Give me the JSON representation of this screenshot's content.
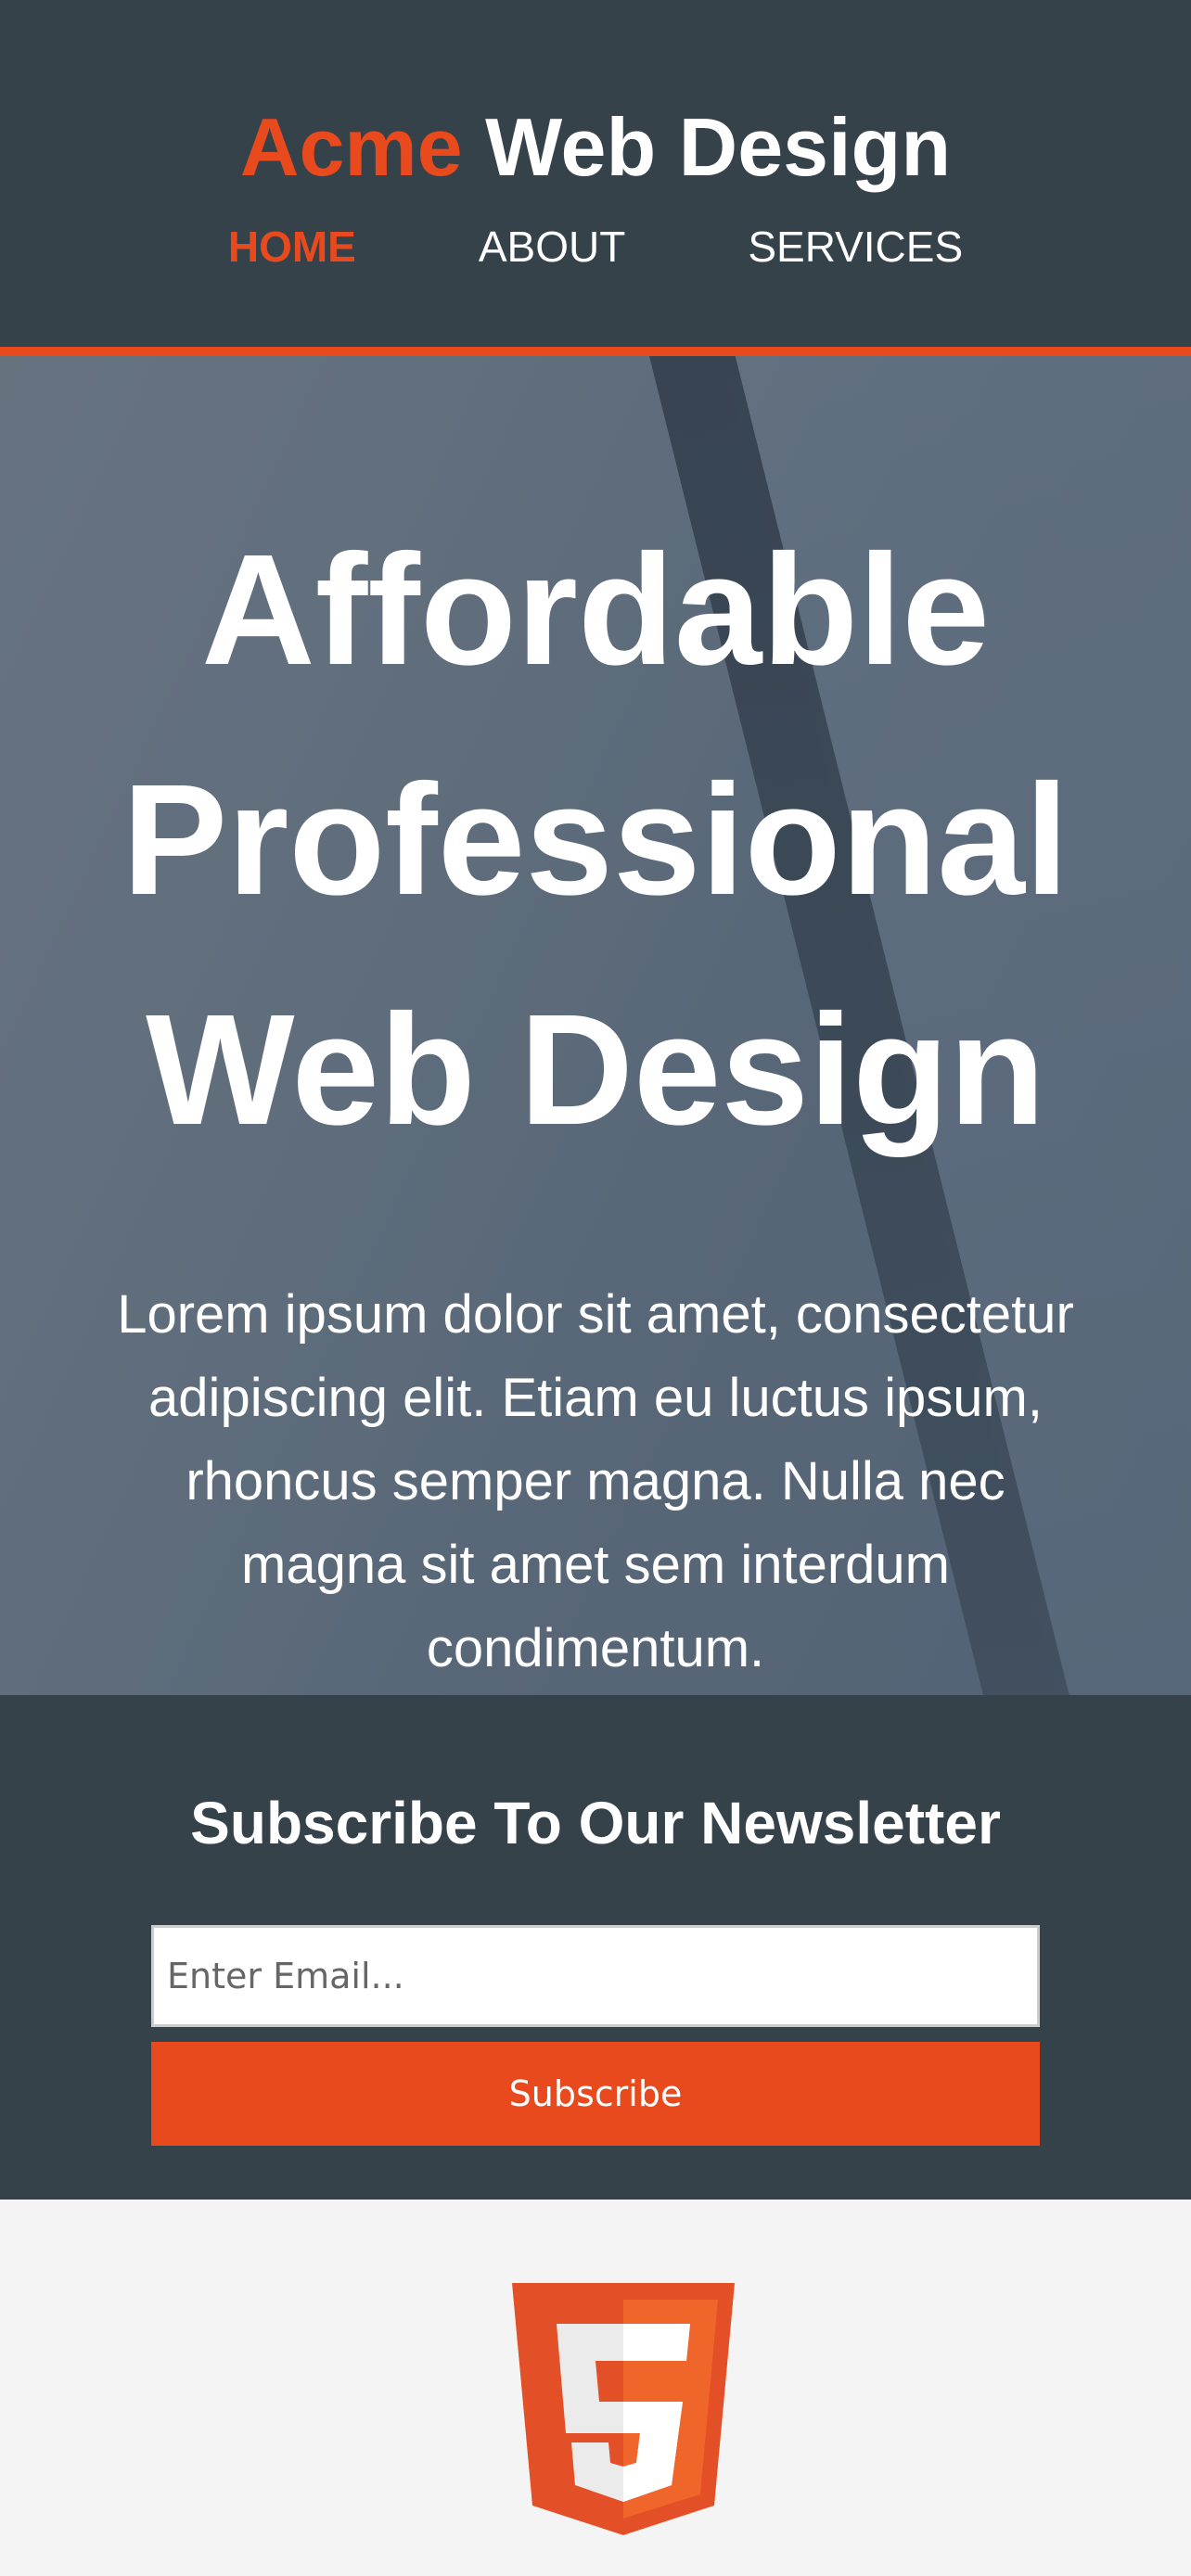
{
  "brand": {
    "highlight": "Acme",
    "rest": "Web Design"
  },
  "nav": {
    "items": [
      {
        "label": "HOME",
        "current": true
      },
      {
        "label": "ABOUT",
        "current": false
      },
      {
        "label": "SERVICES",
        "current": false
      }
    ]
  },
  "showcase": {
    "heading": "Affordable Professional Web Design",
    "text": "Lorem ipsum dolor sit amet, consectetur adipiscing elit. Etiam eu luctus ipsum, rhoncus semper magna. Nulla nec magna sit amet sem interdum condimentum."
  },
  "newsletter": {
    "title": "Subscribe To Our Newsletter",
    "email_placeholder": "Enter Email...",
    "button_label": "Subscribe"
  },
  "footer": {
    "logo_icon": "html5-icon"
  },
  "colors": {
    "accent": "#e8491d",
    "dark": "#35424a",
    "light": "#f4f4f4"
  }
}
